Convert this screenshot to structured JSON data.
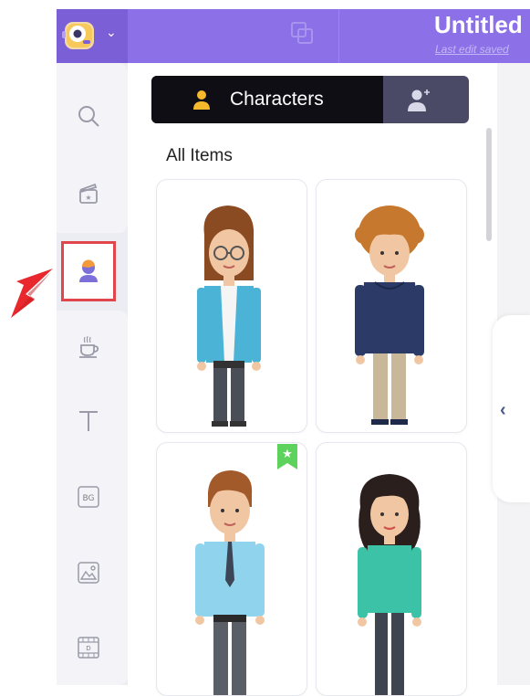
{
  "header": {
    "title": "Untitled",
    "save_status": "Last edit saved"
  },
  "sidebar": {
    "items": [
      {
        "name": "search",
        "icon": "search-icon"
      },
      {
        "name": "scenes",
        "icon": "clapperboard-icon"
      },
      {
        "name": "characters",
        "icon": "character-icon",
        "selected": true
      },
      {
        "name": "props",
        "icon": "coffee-cup-icon"
      },
      {
        "name": "text",
        "icon": "text-icon"
      },
      {
        "name": "backgrounds",
        "icon": "bg-icon",
        "label": "BG"
      },
      {
        "name": "images",
        "icon": "image-icon"
      },
      {
        "name": "videos",
        "icon": "video-icon",
        "label": "D"
      }
    ]
  },
  "tabs": {
    "characters_label": "Characters",
    "add_character_icon": "add-person-icon"
  },
  "main": {
    "section_title": "All Items",
    "items": [
      {
        "name": "woman-glasses-blue-blazer"
      },
      {
        "name": "man-curly-hair-navy-hoodie"
      },
      {
        "name": "man-blue-shirt-tie",
        "premium": true
      },
      {
        "name": "woman-curly-hair-teal-blouse"
      }
    ]
  },
  "colors": {
    "header": "#8b70e8",
    "accent": "#7a5fd6",
    "highlight_box": "#e0464c",
    "tab_active": "#0e0e14",
    "tab_inactive": "#4b4a66",
    "premium_badge": "#5dd35d"
  }
}
